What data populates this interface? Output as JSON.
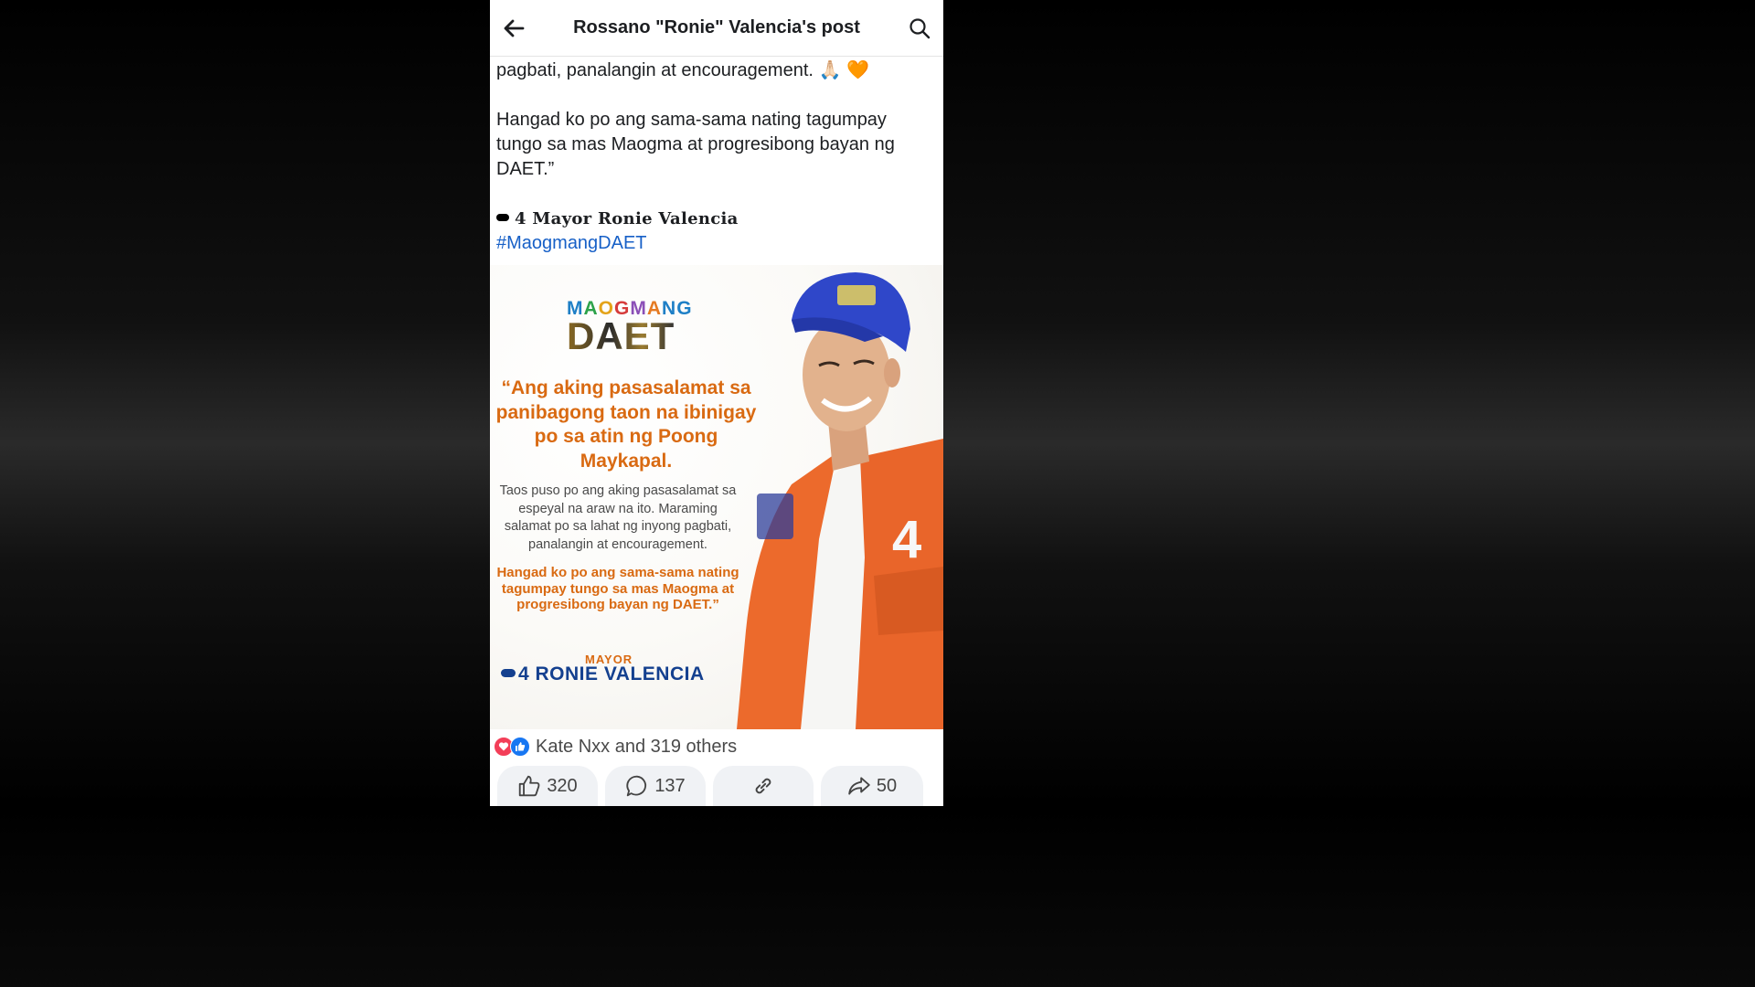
{
  "topbar": {
    "title": "Rossano \"Ronie\" Valencia's post",
    "back_icon": "arrow-left-icon",
    "search_icon": "search-icon"
  },
  "post": {
    "line1": "pagbati, panalangin at encouragement.",
    "line1_emoji": "🙏🏻 🧡",
    "para2": "Hangad ko po ang sama-sama nating tagumpay tungo sa mas Maogma at progresibong bayan ng DAET.”",
    "signature": "4 Mayor Ronie Valencia",
    "hashtag": "#MaogmangDAET"
  },
  "poster": {
    "logo_top": [
      "M",
      "A",
      "O",
      "G",
      "M",
      "A",
      "NG"
    ],
    "logo_bottom": "DAET",
    "quote": "“Ang aking pasasalamat sa panibagong taon na ibinigay po sa atin ng Poong Maykapal.",
    "body": "Taos puso po ang aking pasasalamat sa espeyal na araw na ito. Maraming salamat po sa lahat ng inyong pagbati, panalangin at encouragement.",
    "body2": "Hangad ko po ang sama-sama nating tagumpay tungo sa mas Maogma at progresibong bayan ng DAET.”",
    "mayor_label": "MAYOR",
    "mayor_name": "4 RONIE VALENCIA",
    "vest_number": "4",
    "colors": {
      "orange": "#d96a12",
      "navy": "#14408f",
      "vest": "#ec6a2c",
      "cap": "#2f47c9"
    }
  },
  "reactions": {
    "text": "Kate Nxx and 319 others",
    "icons": [
      "heart-icon",
      "thumbs-up-icon"
    ]
  },
  "actions": {
    "like_count": "320",
    "comment_count": "137",
    "share_count": "50"
  }
}
